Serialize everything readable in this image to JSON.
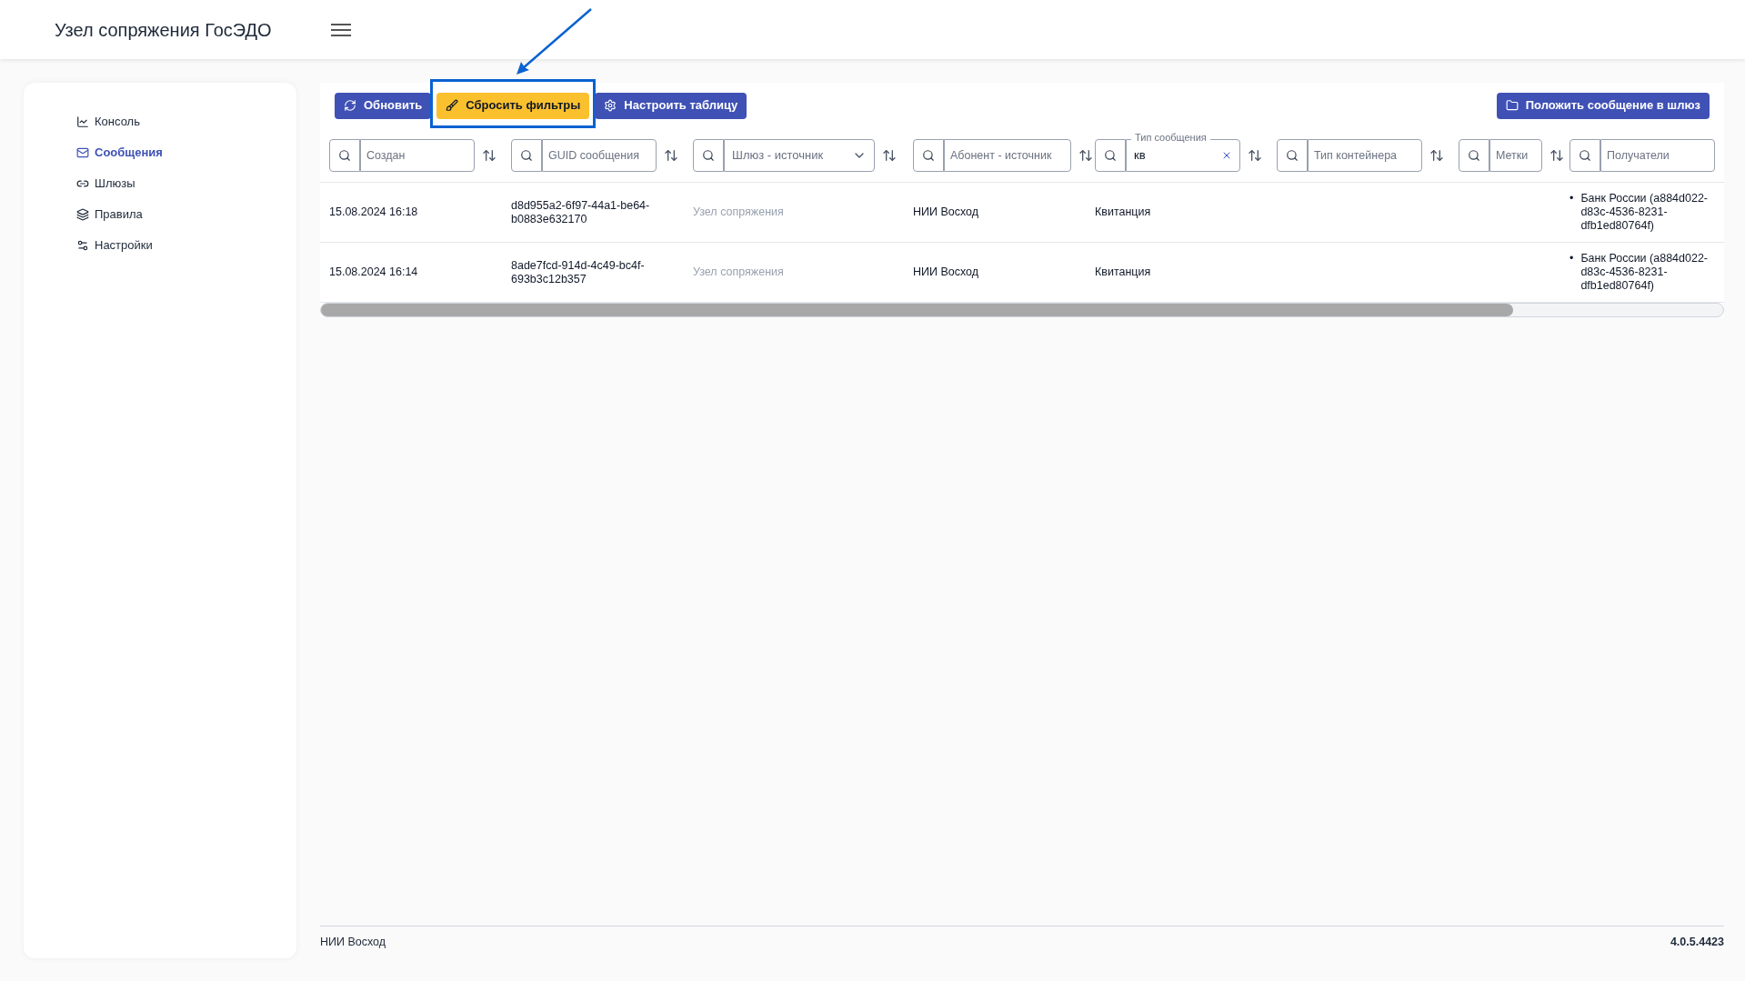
{
  "header": {
    "title": "Узел сопряжения ГосЭДО"
  },
  "sidebar": {
    "items": [
      {
        "label": "Консоль",
        "selected": false
      },
      {
        "label": "Сообщения",
        "selected": true
      },
      {
        "label": "Шлюзы",
        "selected": false
      },
      {
        "label": "Правила",
        "selected": false
      },
      {
        "label": "Настройки",
        "selected": false
      }
    ]
  },
  "toolbar": {
    "buttons": [
      {
        "label": "Обновить",
        "kind": "primary",
        "highlighted": false
      },
      {
        "label": "Сбросить фильтры",
        "kind": "warning",
        "highlighted": true
      },
      {
        "label": "Настроить таблицу",
        "kind": "primary",
        "highlighted": false
      }
    ],
    "right_button": {
      "label": "Положить сообщение в шлюз"
    }
  },
  "table": {
    "columns": [
      {
        "kind": "text",
        "placeholder": "Создан",
        "sortable": true
      },
      {
        "kind": "text",
        "placeholder": "GUID сообщения",
        "sortable": true
      },
      {
        "kind": "select",
        "placeholder": "Шлюз - источник",
        "sortable": true
      },
      {
        "kind": "text",
        "placeholder": "Абонент - источник",
        "sortable": true
      },
      {
        "kind": "labeled",
        "label": "Тип сообщения",
        "value": "кв",
        "sortable": true
      },
      {
        "kind": "text",
        "placeholder": "Тип контейнера",
        "sortable": true
      },
      {
        "kind": "text",
        "placeholder": "Метки",
        "sortable": true
      },
      {
        "kind": "text",
        "placeholder": "Получатели",
        "sortable": false
      }
    ],
    "rows": [
      {
        "cells": [
          {
            "kind": "text",
            "text": "15.08.2024 16:18",
            "muted": false
          },
          {
            "kind": "text",
            "text": "d8d955a2-6f97-44a1-be64-b0883e632170",
            "muted": false
          },
          {
            "kind": "text",
            "text": "Узел сопряжения",
            "muted": true
          },
          {
            "kind": "text",
            "text": "НИИ Восход",
            "muted": false
          },
          {
            "kind": "text",
            "text": "Квитанция",
            "muted": false
          },
          {
            "kind": "empty"
          },
          {
            "kind": "empty"
          },
          {
            "kind": "list",
            "bullet": "•",
            "items": [
              "Банк России (a884d022-d83c-4536-8231-dfb1ed80764f)"
            ]
          }
        ]
      },
      {
        "cells": [
          {
            "kind": "text",
            "text": "15.08.2024 16:14",
            "muted": false
          },
          {
            "kind": "text",
            "text": "8ade7fcd-914d-4c49-bc4f-693b3c12b357",
            "muted": false
          },
          {
            "kind": "text",
            "text": "Узел сопряжения",
            "muted": true
          },
          {
            "kind": "text",
            "text": "НИИ Восход",
            "muted": false
          },
          {
            "kind": "text",
            "text": "Квитанция",
            "muted": false
          },
          {
            "kind": "empty"
          },
          {
            "kind": "empty"
          },
          {
            "kind": "list",
            "bullet": "•",
            "items": [
              "Банк России (a884d022-d83c-4536-8231-dfb1ed80764f)"
            ]
          }
        ]
      }
    ]
  },
  "footer": {
    "left": "НИИ Восход",
    "version": "4.0.5.4423"
  }
}
